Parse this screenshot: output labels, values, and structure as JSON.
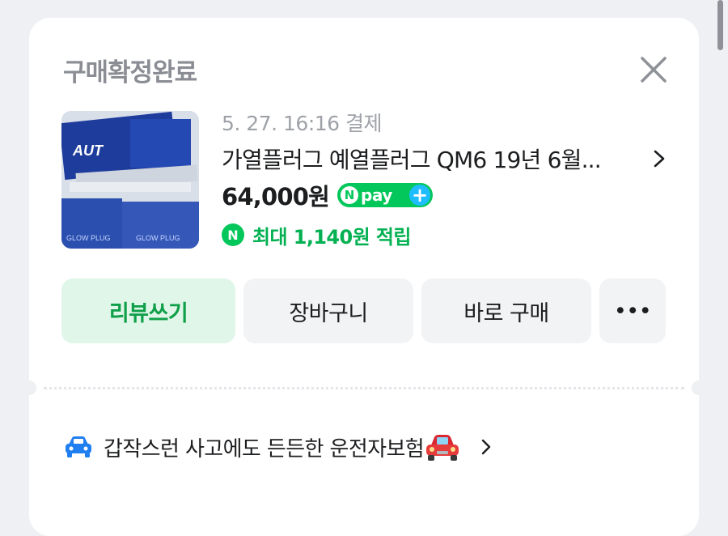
{
  "modal": {
    "title": "구매확정완료",
    "close_icon": "close-icon"
  },
  "order": {
    "date": "5. 27. 16:16 결제",
    "product_name": "가열플러그 예열플러그 QM6 19년 6월...",
    "price": "64,000원",
    "npay_badge": {
      "n": "N",
      "text": "pay",
      "plus": "+"
    },
    "reward": {
      "icon": "N",
      "text": "최대 1,140원 적립"
    },
    "thumbnail": "product-thumbnail"
  },
  "actions": {
    "review": "리뷰쓰기",
    "cart": "장바구니",
    "buy_now": "바로 구매",
    "more": "•••"
  },
  "banner": {
    "text": "갑작스런 사고에도 든든한 운전자보험",
    "left_icon": "car-icon",
    "right_icon": "red-car-icon"
  },
  "colors": {
    "accent_green": "#03c75a",
    "review_bg": "#dff6e8",
    "review_text": "#0f9f49",
    "npay_plus_blue": "#1ebdff",
    "car_blue": "#1f7ef0"
  }
}
